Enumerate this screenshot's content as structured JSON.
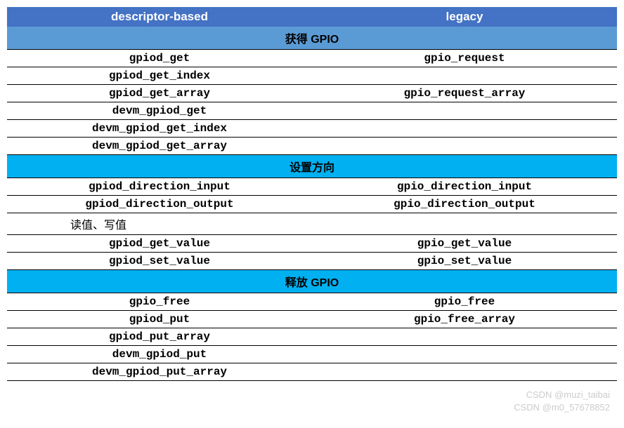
{
  "headers": {
    "col1": "descriptor-based",
    "col2": "legacy"
  },
  "sections": [
    {
      "title": "获得 GPIO",
      "style": "blue-light",
      "rows": [
        {
          "c1": "gpiod_get",
          "c2": "gpio_request"
        },
        {
          "c1": "gpiod_get_index",
          "c2": ""
        },
        {
          "c1": "gpiod_get_array",
          "c2": "gpio_request_array"
        },
        {
          "c1": "devm_gpiod_get",
          "c2": ""
        },
        {
          "c1": "devm_gpiod_get_index",
          "c2": ""
        },
        {
          "c1": "devm_gpiod_get_array",
          "c2": ""
        }
      ]
    },
    {
      "title": "设置方向",
      "style": "cyan",
      "rows": [
        {
          "c1": "gpiod_direction_input",
          "c2": "gpio_direction_input"
        },
        {
          "c1": "gpiod_direction_output",
          "c2": "gpio_direction_output"
        }
      ]
    },
    {
      "subheader": "读值、写值",
      "rows": [
        {
          "c1": "gpiod_get_value",
          "c2": "gpio_get_value"
        },
        {
          "c1": "gpiod_set_value",
          "c2": "gpio_set_value"
        }
      ]
    },
    {
      "title": "释放 GPIO",
      "style": "cyan",
      "rows": [
        {
          "c1": "gpio_free",
          "c2": "gpio_free"
        },
        {
          "c1": "gpiod_put",
          "c2": "gpio_free_array"
        },
        {
          "c1": "gpiod_put_array",
          "c2": ""
        },
        {
          "c1": "devm_gpiod_put",
          "c2": ""
        },
        {
          "c1": "devm_gpiod_put_array",
          "c2": ""
        }
      ]
    }
  ],
  "watermark": {
    "line1": "CSDN @muzi_taibai",
    "line2": "CSDN @m0_57678852"
  }
}
